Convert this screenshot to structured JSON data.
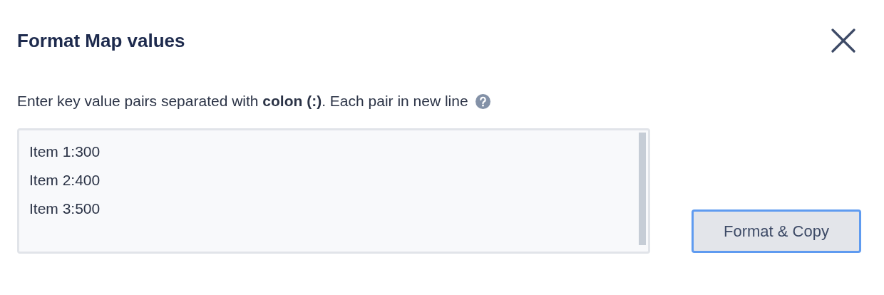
{
  "dialog": {
    "title": "Format Map values"
  },
  "instruction": "Enter key value pairs separated with **colon (:)**. Each pair in new line",
  "input": {
    "value": "Item 1:300\nItem 2:400\nItem 3:500"
  },
  "button": {
    "label": "Format & Copy",
    "focused": true
  }
}
